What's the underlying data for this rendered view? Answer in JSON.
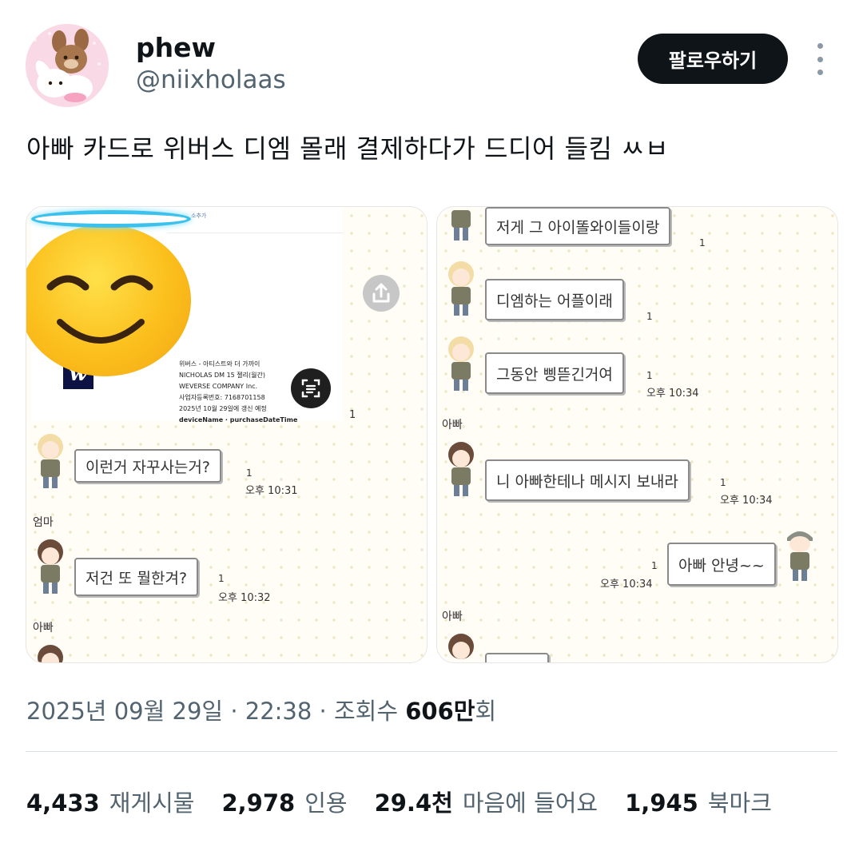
{
  "user": {
    "display_name": "phew",
    "handle": "@niixholaas",
    "follow_label": "팔로우하기",
    "avatar_icon": "bunny-avatar-icon",
    "more_icon": "more-dots-icon"
  },
  "tweet": {
    "text": "아빠 카드로 위버스 디엠 몰래 결제하다가 드디어 들킴 ㅆㅂ"
  },
  "media": {
    "left": {
      "receipt_top": "소추가",
      "receipt_lines": [
        "위버스 - 아티스트와 더 가까이",
        "NICHOLAS DM 15 젤리(월간)",
        "WEVERSE COMPANY Inc.",
        "사업자등록번호: 7168701158",
        "2025년 10월 29일에 갱신 예정",
        "deviceName · purchaseDateTime"
      ],
      "logo_letter": "w",
      "receipt_read": "1",
      "messages": [
        {
          "text": "이런거 자꾸사는거?",
          "read": "1",
          "time": "오후 10:31"
        },
        {
          "sender": "엄마",
          "text": "저건 또 뭘한겨?",
          "read": "1",
          "time": "오후 10:32"
        }
      ],
      "trailing_sender": "아빠"
    },
    "right": {
      "messages": [
        {
          "text": "저게 그 아이똘와이들이랑",
          "read": "1"
        },
        {
          "text": "디엠하는 어플이래",
          "read": "1"
        },
        {
          "text": "그동안 삥뜯긴거여",
          "read": "1",
          "time": "오후 10:34"
        },
        {
          "sender": "아빠",
          "text": "니 아빠한테나 메시지 보내라",
          "read": "1",
          "time": "오후 10:34"
        },
        {
          "text": "아빠 안녕~~",
          "read": "1",
          "time": "오후 10:34"
        }
      ],
      "trailing_sender": "아빠"
    }
  },
  "meta": {
    "date": "2025년 09월 29일",
    "sep1": "·",
    "time": "22:38",
    "sep2": "·",
    "views_label": "조회수",
    "views_num": "606만",
    "views_suffix": "회"
  },
  "stats": {
    "reposts": {
      "num": "4,433",
      "label": "재게시물"
    },
    "quotes": {
      "num": "2,978",
      "label": "인용"
    },
    "likes": {
      "num": "29.4천",
      "label": "마음에 들어요"
    },
    "bookmarks": {
      "num": "1,945",
      "label": "북마크"
    }
  },
  "colors": {
    "text": "#0f1419",
    "secondary": "#536471",
    "follow_bg": "#0f1419",
    "divider": "#d9dfe3"
  }
}
